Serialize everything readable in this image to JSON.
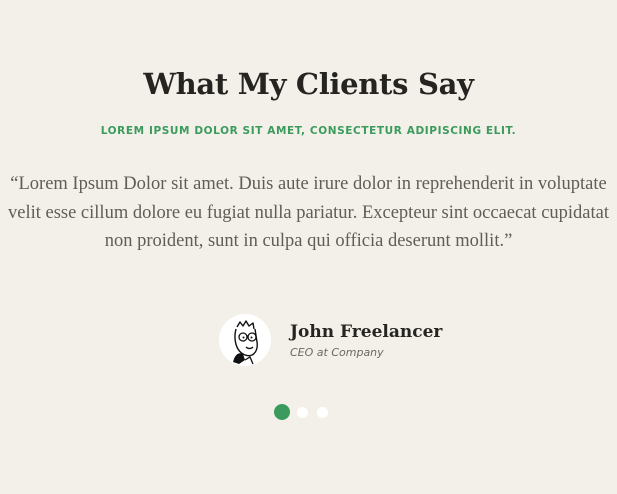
{
  "testimonials": {
    "title": "What My Clients Say",
    "subtitle": "LOREM IPSUM DOLOR SIT AMET, CONSECTETUR ADIPISCING ELIT.",
    "quote": "“Lorem Ipsum Dolor sit amet. Duis aute irure dolor in reprehenderit in voluptate velit esse cillum dolore eu fugiat nulla pariatur. Excepteur sint occaecat cupidatat non proident, sunt in culpa qui officia deserunt mollit.”",
    "author": {
      "name": "John Freelancer",
      "role": "CEO at Company",
      "avatar_icon": "cartoon-face-avatar"
    },
    "pagination": {
      "count": 3,
      "active_index": 0
    },
    "colors": {
      "background": "#f3f0e9",
      "accent": "#3a9b5c",
      "heading": "#262421",
      "body_text": "#5f5d58"
    }
  }
}
